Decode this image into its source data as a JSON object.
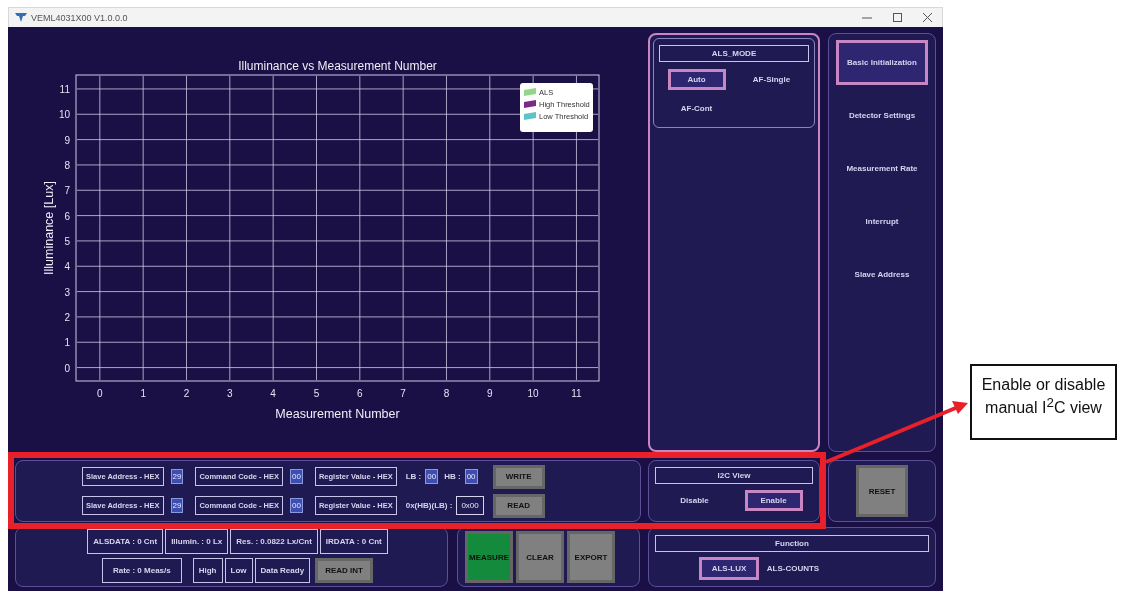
{
  "window": {
    "title": "VEML4031X00 V1.0.0.0"
  },
  "chart": {
    "chart_data": {
      "type": "line",
      "title": "Illuminance vs Measurement Number",
      "xlabel": "Measurement Number",
      "ylabel": "Illuminance [Lux]",
      "grid": true,
      "categories": [
        "0",
        "1",
        "2",
        "3",
        "4",
        "5",
        "6",
        "7",
        "8",
        "9",
        "10",
        "11"
      ],
      "ylim": [
        -0.53,
        11.55
      ],
      "yticks": [
        0,
        1,
        2,
        3,
        4,
        5,
        6,
        7,
        8,
        9,
        10,
        11
      ],
      "series": [
        {
          "name": "ALS",
          "color": "#93d68a",
          "values": [
            null,
            null,
            null,
            null,
            null,
            null,
            null,
            null,
            null,
            null,
            null,
            null
          ]
        },
        {
          "name": "High Threshold",
          "color": "#7a2a86",
          "values": [
            null,
            null,
            null,
            null,
            null,
            null,
            null,
            null,
            null,
            null,
            null,
            null
          ]
        },
        {
          "name": "Low Threshold",
          "color": "#5cc4c4",
          "values": [
            null,
            null,
            null,
            null,
            null,
            null,
            null,
            null,
            null,
            null,
            null,
            null
          ]
        }
      ]
    }
  },
  "als_mode": {
    "title": "ALS_MODE",
    "options": [
      {
        "label": "Auto",
        "selected": true
      },
      {
        "label": "AF-Single",
        "selected": false
      },
      {
        "label": "AF-Cont",
        "selected": false
      }
    ]
  },
  "nav": {
    "items": [
      {
        "label": "Basic Initialization",
        "selected": true
      },
      {
        "label": "Detector Settings",
        "selected": false
      },
      {
        "label": "Measurement Rate",
        "selected": false
      },
      {
        "label": "Interrupt",
        "selected": false
      },
      {
        "label": "Slave Address",
        "selected": false
      }
    ]
  },
  "i2c": {
    "rows": [
      {
        "kind": "write",
        "slave_label": "Slave Address - HEX",
        "slave": "29",
        "command_label": "Command Code - HEX",
        "command": "00",
        "register_label": "Register Value - HEX",
        "lb_label": "LB :",
        "lb": "00",
        "hb_label": "HB :",
        "hb": "00",
        "button": "WRITE"
      },
      {
        "kind": "read",
        "slave_label": "Slave Address - HEX",
        "slave": "29",
        "command_label": "Command Code - HEX",
        "command": "00",
        "register_label": "Register Value - HEX",
        "result_label": "0x(HB)(LB) :",
        "result": "0x00",
        "button": "READ"
      }
    ]
  },
  "status": {
    "readings": [
      "ALSDATA : 0 Cnt",
      "Illumin. : 0 Lx",
      "Res. : 0.0822 Lx/Cnt",
      "IRDATA : 0 Cnt"
    ],
    "rate": "Rate : 0 Meas/s",
    "flags": [
      "High",
      "Low",
      "Data Ready"
    ],
    "button": "READ INT"
  },
  "actions": [
    {
      "label": "MEASURE",
      "kind": "primary"
    },
    {
      "label": "CLEAR",
      "kind": "plain"
    },
    {
      "label": "EXPORT",
      "kind": "plain"
    }
  ],
  "i2c_view": {
    "title": "I2C View",
    "options": [
      {
        "label": "Disable",
        "selected": false
      },
      {
        "label": "Enable",
        "selected": true
      }
    ]
  },
  "reset_button": "RESET",
  "function": {
    "title": "Function",
    "options": [
      {
        "label": "ALS-LUX",
        "selected": true
      },
      {
        "label": "ALS-COUNTS",
        "selected": false
      }
    ]
  },
  "annotation": {
    "text": "Enable or disable manual I$^{2}$C view"
  }
}
